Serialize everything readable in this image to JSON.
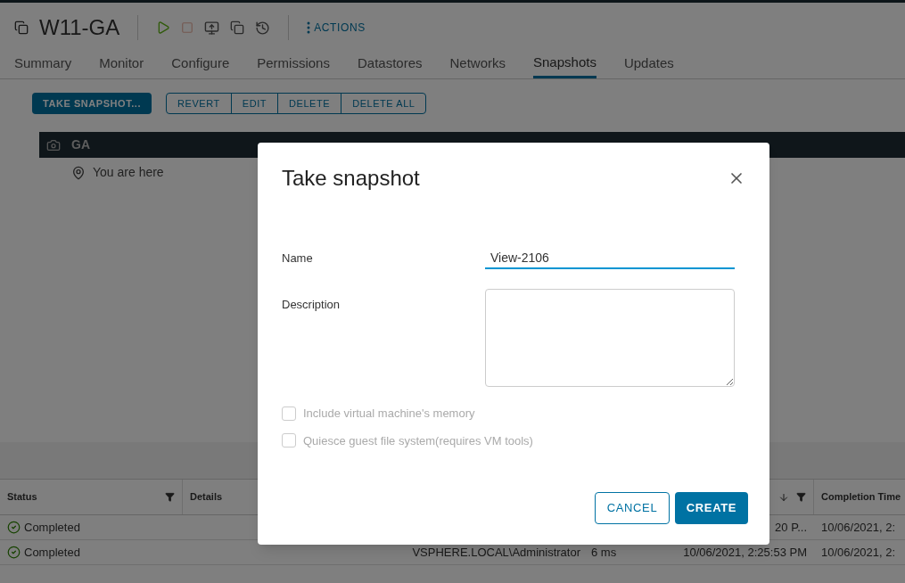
{
  "vm": {
    "name": "W11-GA",
    "actions": "ACTIONS"
  },
  "tabs": [
    {
      "label": "Summary",
      "selected": false
    },
    {
      "label": "Monitor",
      "selected": false
    },
    {
      "label": "Configure",
      "selected": false
    },
    {
      "label": "Permissions",
      "selected": false
    },
    {
      "label": "Datastores",
      "selected": false
    },
    {
      "label": "Networks",
      "selected": false
    },
    {
      "label": "Snapshots",
      "selected": true
    },
    {
      "label": "Updates",
      "selected": false
    }
  ],
  "toolbar": {
    "primary": "TAKE SNAPSHOT...",
    "group": [
      "REVERT",
      "EDIT",
      "DELETE",
      "DELETE ALL"
    ]
  },
  "snapshot_tree": {
    "snapshot": "GA",
    "current": "You are here"
  },
  "tasks": {
    "columns": [
      {
        "label": "Status",
        "filter": true,
        "sorted": false
      },
      {
        "label": "Details",
        "filter": false,
        "sorted": false
      },
      {},
      {},
      {
        "filter": true,
        "sorted": true
      },
      {
        "label": "Completion Time",
        "filter": false,
        "sorted": false
      }
    ],
    "rows": [
      {
        "status": "Completed",
        "start": "20 P...",
        "completion": "10/06/2021, 2:"
      },
      {
        "status": "Completed",
        "initiator": "VSPHERE.LOCAL\\Administrator",
        "duration": "6 ms",
        "start": "10/06/2021, 2:25:53 PM",
        "completion": "10/06/2021, 2:"
      }
    ]
  },
  "dialog": {
    "title": "Take snapshot",
    "name_label": "Name",
    "name_value": "View-2106",
    "description_label": "Description",
    "options": [
      {
        "label": "Include virtual machine's memory",
        "checked": false,
        "disabled": true
      },
      {
        "label": "Quiesce guest file system(requires VM tools)",
        "checked": false,
        "disabled": true
      }
    ],
    "cancel": "CANCEL",
    "create": "CREATE"
  }
}
